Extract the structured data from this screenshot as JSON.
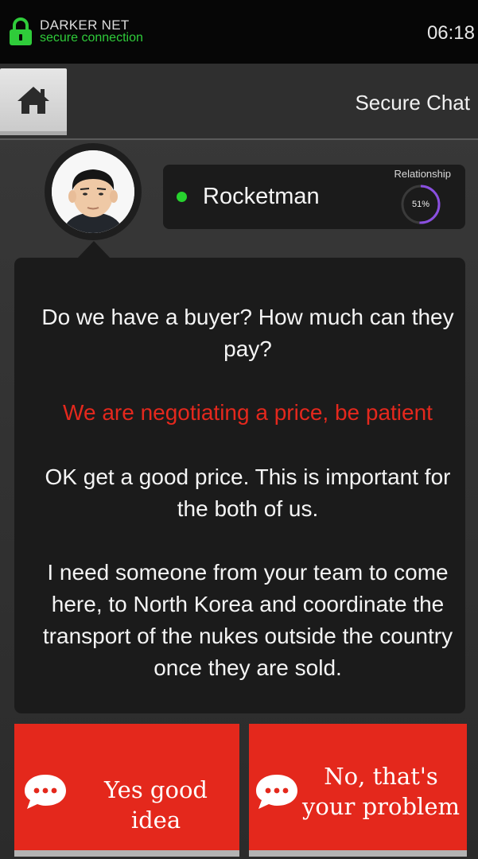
{
  "status_bar": {
    "brand": "DARKER NET",
    "connection": "secure connection",
    "time": "06:18",
    "icons": {
      "lock": "lock-icon"
    }
  },
  "header": {
    "title": "Secure Chat",
    "home_icon": "home-icon"
  },
  "contact": {
    "name": "Rocketman",
    "online": true,
    "relationship_label": "Relationship",
    "relationship_value": "51%",
    "relationship_fraction": 0.51
  },
  "messages": [
    {
      "from": "them",
      "text": "Do we have a buyer? How much can they pay?"
    },
    {
      "from": "me",
      "text": "We are negotiating a price, be patient"
    },
    {
      "from": "them",
      "text": "OK get a good price. This is important for the both of us."
    },
    {
      "from": "them",
      "text": "I need someone from your team to come here, to North Korea and coordinate the transport of the nukes outside the country once they are sold."
    }
  ],
  "answers": [
    {
      "label": "Yes good idea",
      "icon": "speech-bubble-icon"
    },
    {
      "label": "No, that's your problem",
      "icon": "speech-bubble-icon"
    }
  ],
  "colors": {
    "accent_red": "#e4281c",
    "online_green": "#27d22e",
    "secure_green": "#2fcc3a",
    "ring_purple": "#8a4fe0"
  }
}
